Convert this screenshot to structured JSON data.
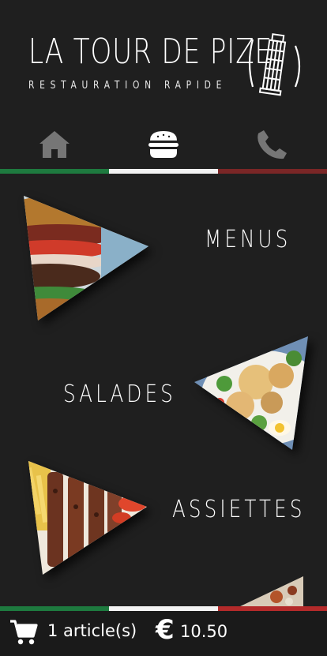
{
  "header": {
    "title": "LA TOUR DE PIZE",
    "subtitle": "RESTAURATION RAPIDE",
    "logo_icon": "leaning-tower-icon"
  },
  "nav": {
    "tabs": [
      {
        "icon": "home-icon",
        "active": false
      },
      {
        "icon": "burger-icon",
        "active": true
      },
      {
        "icon": "phone-icon",
        "active": false
      }
    ]
  },
  "categories": [
    {
      "label": "MENUS",
      "image": "burger-photo"
    },
    {
      "label": "SALADES",
      "image": "salad-photo"
    },
    {
      "label": "ASSIETTES",
      "image": "kebab-plate-photo"
    }
  ],
  "cart": {
    "count_text": "1 article(s)",
    "currency_symbol": "€",
    "total": "10.50"
  },
  "colors": {
    "background": "#1f1f1f",
    "flag_green": "#1e7a3f",
    "flag_white": "#f2f2f2",
    "flag_red": "#7a2626"
  }
}
